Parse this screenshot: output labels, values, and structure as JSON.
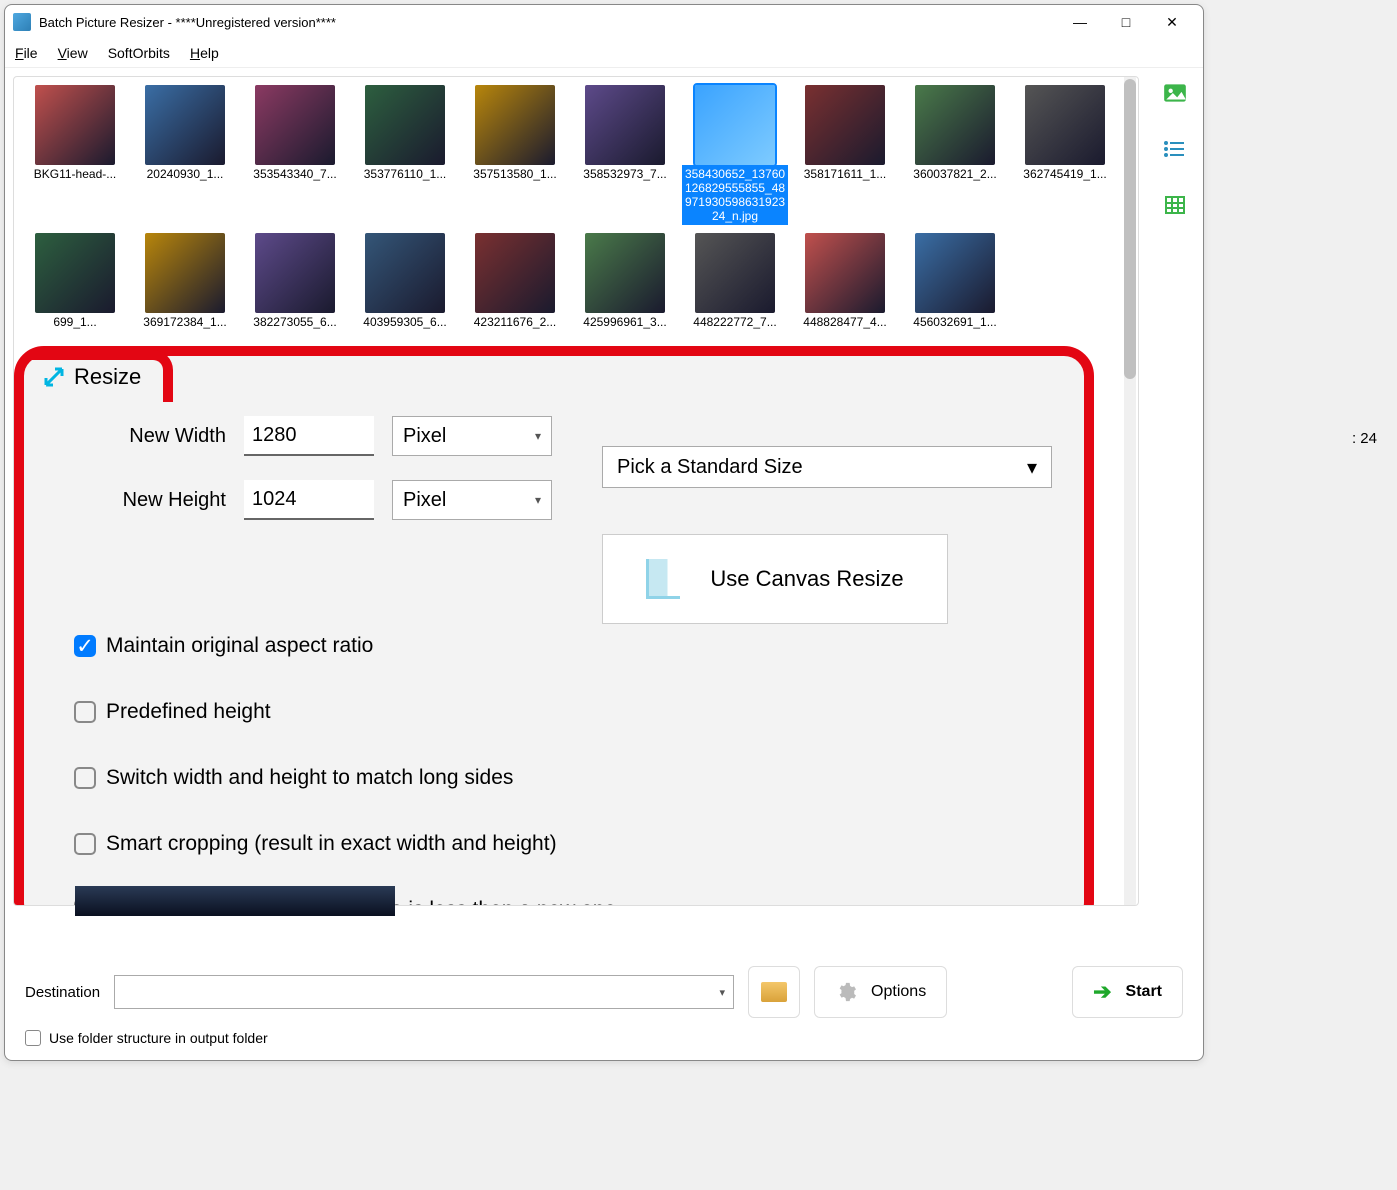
{
  "window": {
    "title": "Batch Picture Resizer - ****Unregistered version****"
  },
  "menu": {
    "file": "File",
    "view": "View",
    "softorbits": "SoftOrbits",
    "help": "Help"
  },
  "thumbs": {
    "row1": [
      {
        "label": "BKG11-head-..."
      },
      {
        "label": "20240930_1..."
      },
      {
        "label": "353543340_7..."
      },
      {
        "label": "353776110_1..."
      },
      {
        "label": "357513580_1..."
      },
      {
        "label": "358532973_7..."
      },
      {
        "label": "358430652_13760126829555855_4897193059863192324_n.jpg",
        "selected": true
      },
      {
        "label": "358171611_1..."
      },
      {
        "label": "360037821_2..."
      },
      {
        "label": "362745419_1..."
      }
    ],
    "row2": [
      {
        "label": "699_1..."
      },
      {
        "label": "369172384_1..."
      },
      {
        "label": "382273055_6..."
      },
      {
        "label": "403959305_6..."
      },
      {
        "label": "423211676_2..."
      },
      {
        "label": "425996961_3..."
      },
      {
        "label": "448222772_7..."
      },
      {
        "label": "448828477_4..."
      },
      {
        "label": "456032691_1..."
      }
    ]
  },
  "resize": {
    "tab_label": "Resize",
    "width_label": "New Width",
    "width_value": "1280",
    "height_label": "New Height",
    "height_value": "1024",
    "unit": "Pixel",
    "standard_size": "Pick a Standard Size",
    "canvas_btn": "Use Canvas Resize",
    "check_aspect": "Maintain original aspect ratio",
    "check_predefined": "Predefined height",
    "check_switch": "Switch width and height to match long sides",
    "check_smart": "Smart cropping (result in exact width and height)",
    "check_noresize": "Do not resize when original size is less then a new one"
  },
  "count_suffix": ": 24",
  "footer": {
    "destination": "Destination",
    "options": "Options",
    "start": "Start",
    "use_folder": "Use folder structure in output folder"
  }
}
